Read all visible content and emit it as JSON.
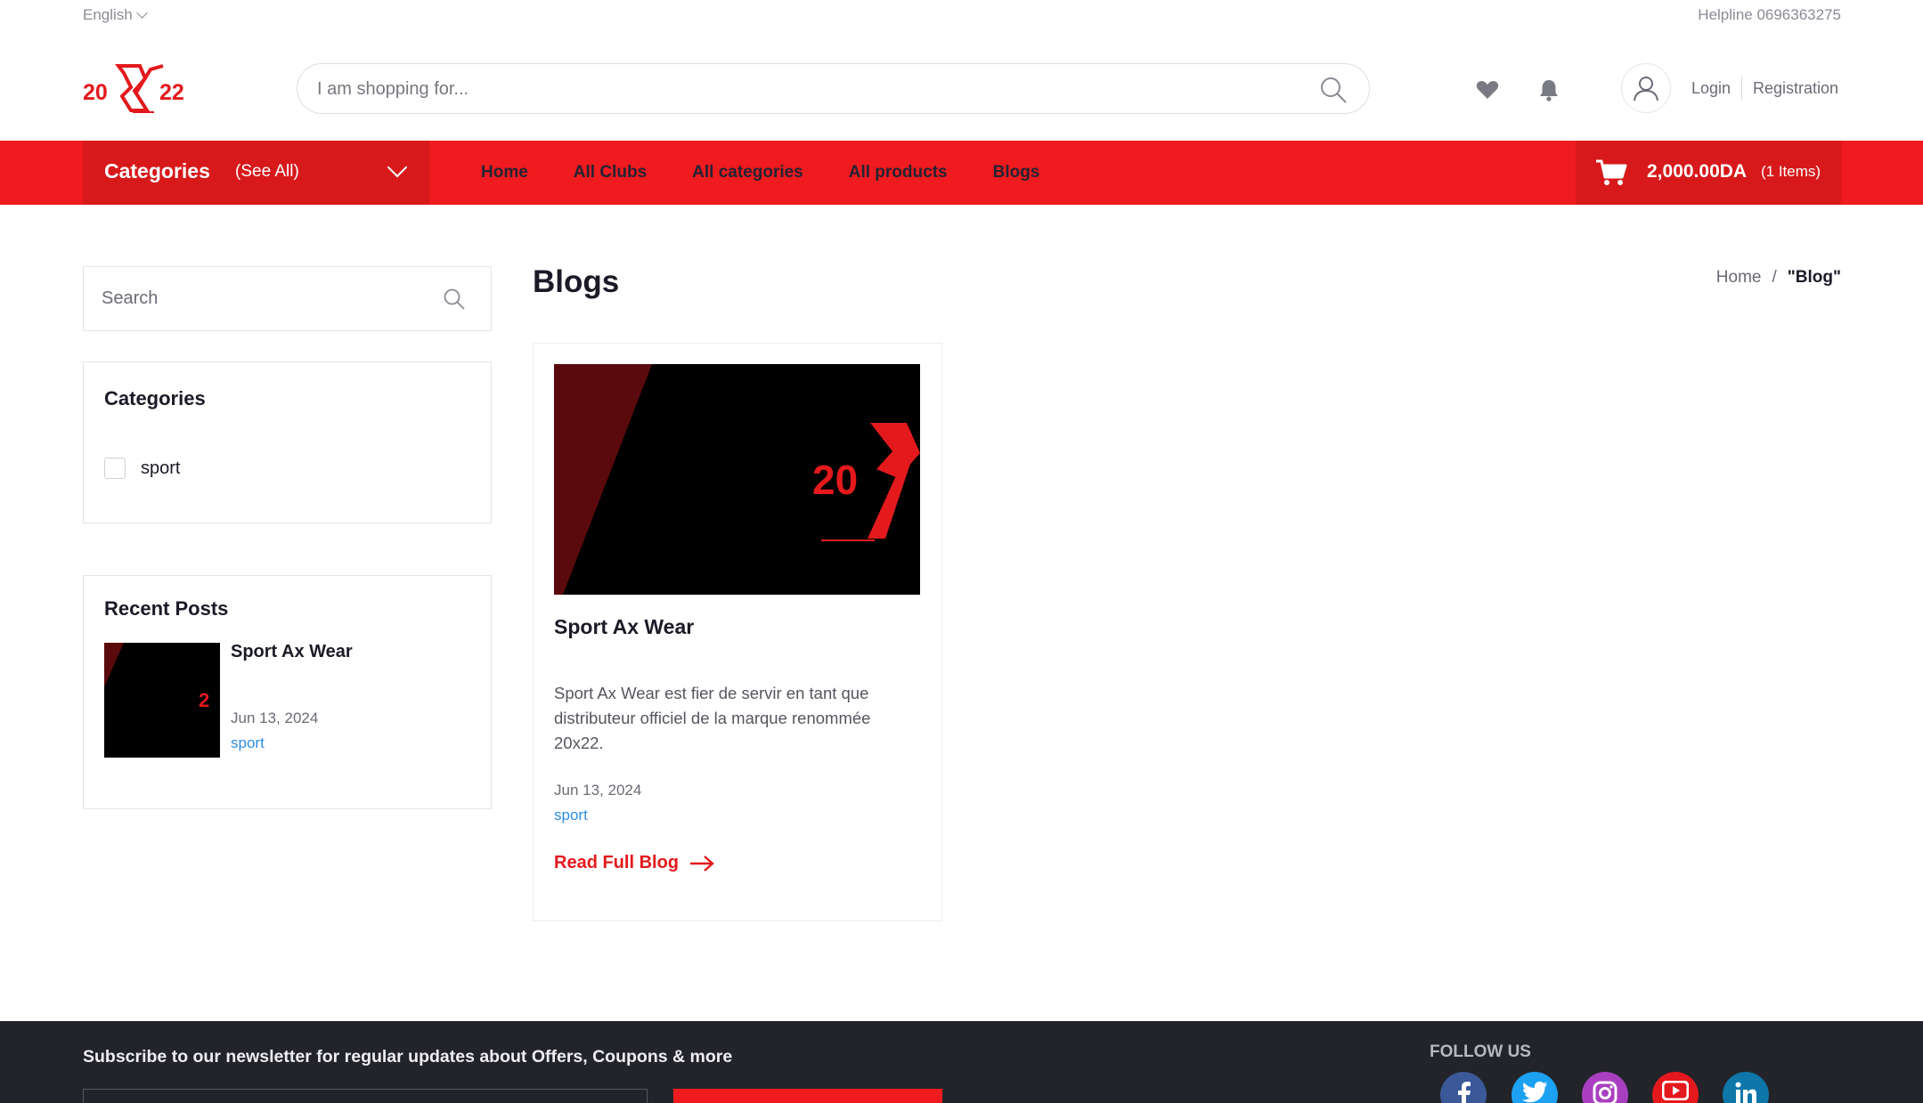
{
  "topbar": {
    "language": "English",
    "helpline": "Helpline 0696363275"
  },
  "header": {
    "logo_text": "20X22",
    "search_placeholder": "I am shopping for...",
    "login_label": "Login",
    "registration_label": "Registration"
  },
  "navbar": {
    "categories_label": "Categories",
    "see_all_label": "(See All)",
    "links": [
      "Home",
      "All Clubs",
      "All categories",
      "All products",
      "Blogs"
    ],
    "cart_amount": "2,000.00DA",
    "cart_items": "(1 Items)"
  },
  "sidebar": {
    "search_placeholder": "Search",
    "categories_title": "Categories",
    "categories": [
      "sport"
    ],
    "recent_title": "Recent Posts",
    "recent_posts": [
      {
        "title": "Sport Ax Wear",
        "date": "Jun 13, 2024",
        "category": "sport"
      }
    ]
  },
  "main": {
    "title": "Blogs",
    "breadcrumb": {
      "home": "Home",
      "separator": "/",
      "current": "\"Blog\""
    },
    "posts": [
      {
        "title": "Sport Ax Wear",
        "excerpt": "Sport Ax Wear est fier de servir en tant que distributeur officiel de la marque renommée 20x22.",
        "date": "Jun 13, 2024",
        "category": "sport",
        "read_more": "Read Full Blog"
      }
    ]
  },
  "footer": {
    "newsletter_text": "Subscribe to our newsletter for regular updates about Offers, Coupons & more",
    "follow_us": "FOLLOW US",
    "social": [
      "facebook-icon",
      "twitter-icon",
      "instagram-icon",
      "youtube-icon",
      "linkedin-icon"
    ]
  },
  "colors": {
    "brand_red": "#ef1b1e",
    "dark_red": "#d7191b",
    "link_blue": "#2f8de4",
    "footer_bg": "#22242a"
  }
}
